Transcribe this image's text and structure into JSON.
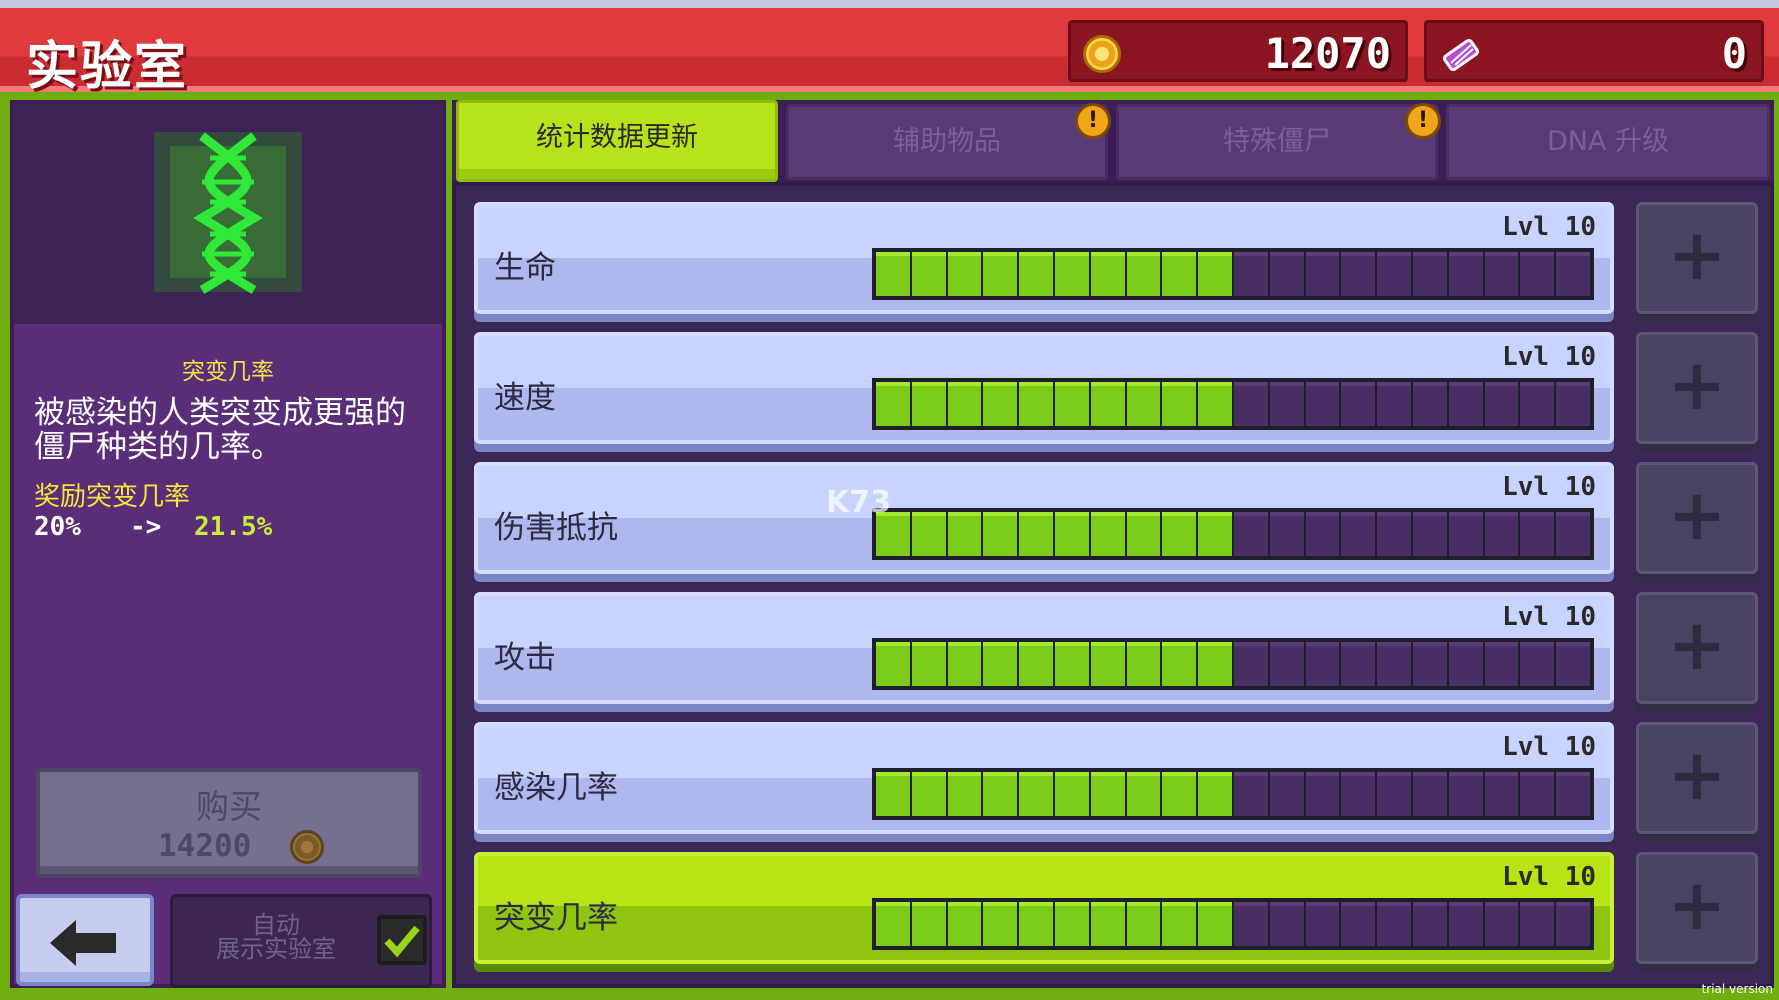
{
  "header": {
    "title": "实验室",
    "coins": "12070",
    "dna": "0"
  },
  "tabs": [
    {
      "label": "统计数据更新",
      "active": true,
      "alert": false
    },
    {
      "label": "辅助物品",
      "active": false,
      "alert": true
    },
    {
      "label": "特殊僵尸",
      "active": false,
      "alert": true
    },
    {
      "label": "DNA 升级",
      "active": false,
      "alert": false
    }
  ],
  "left": {
    "stat_name": "突变几率",
    "description": "被感染的人类突变成更强的僵尸种类的几率。",
    "bonus_label": "奖励突变几率",
    "from": "20%",
    "arrow": "->",
    "to": "21.5%",
    "buy_label": "购买",
    "buy_price": "14200",
    "auto_label_1": "自动",
    "auto_label_2": "展示实验室"
  },
  "stats": [
    {
      "name": "生命",
      "level": "Lvl 10",
      "filled": 10,
      "total": 20
    },
    {
      "name": "速度",
      "level": "Lvl 10",
      "filled": 10,
      "total": 20
    },
    {
      "name": "伤害抵抗",
      "level": "Lvl 10",
      "filled": 10,
      "total": 20
    },
    {
      "name": "攻击",
      "level": "Lvl 10",
      "filled": 10,
      "total": 20
    },
    {
      "name": "感染几率",
      "level": "Lvl 10",
      "filled": 10,
      "total": 20
    },
    {
      "name": "突变几率",
      "level": "Lvl 10",
      "filled": 10,
      "total": 20,
      "selected": true
    }
  ],
  "footer": {
    "trial": "trial version"
  },
  "colors": {
    "accent": "#b7e31a",
    "header": "#e03a3c",
    "panel": "#5a2d78"
  }
}
